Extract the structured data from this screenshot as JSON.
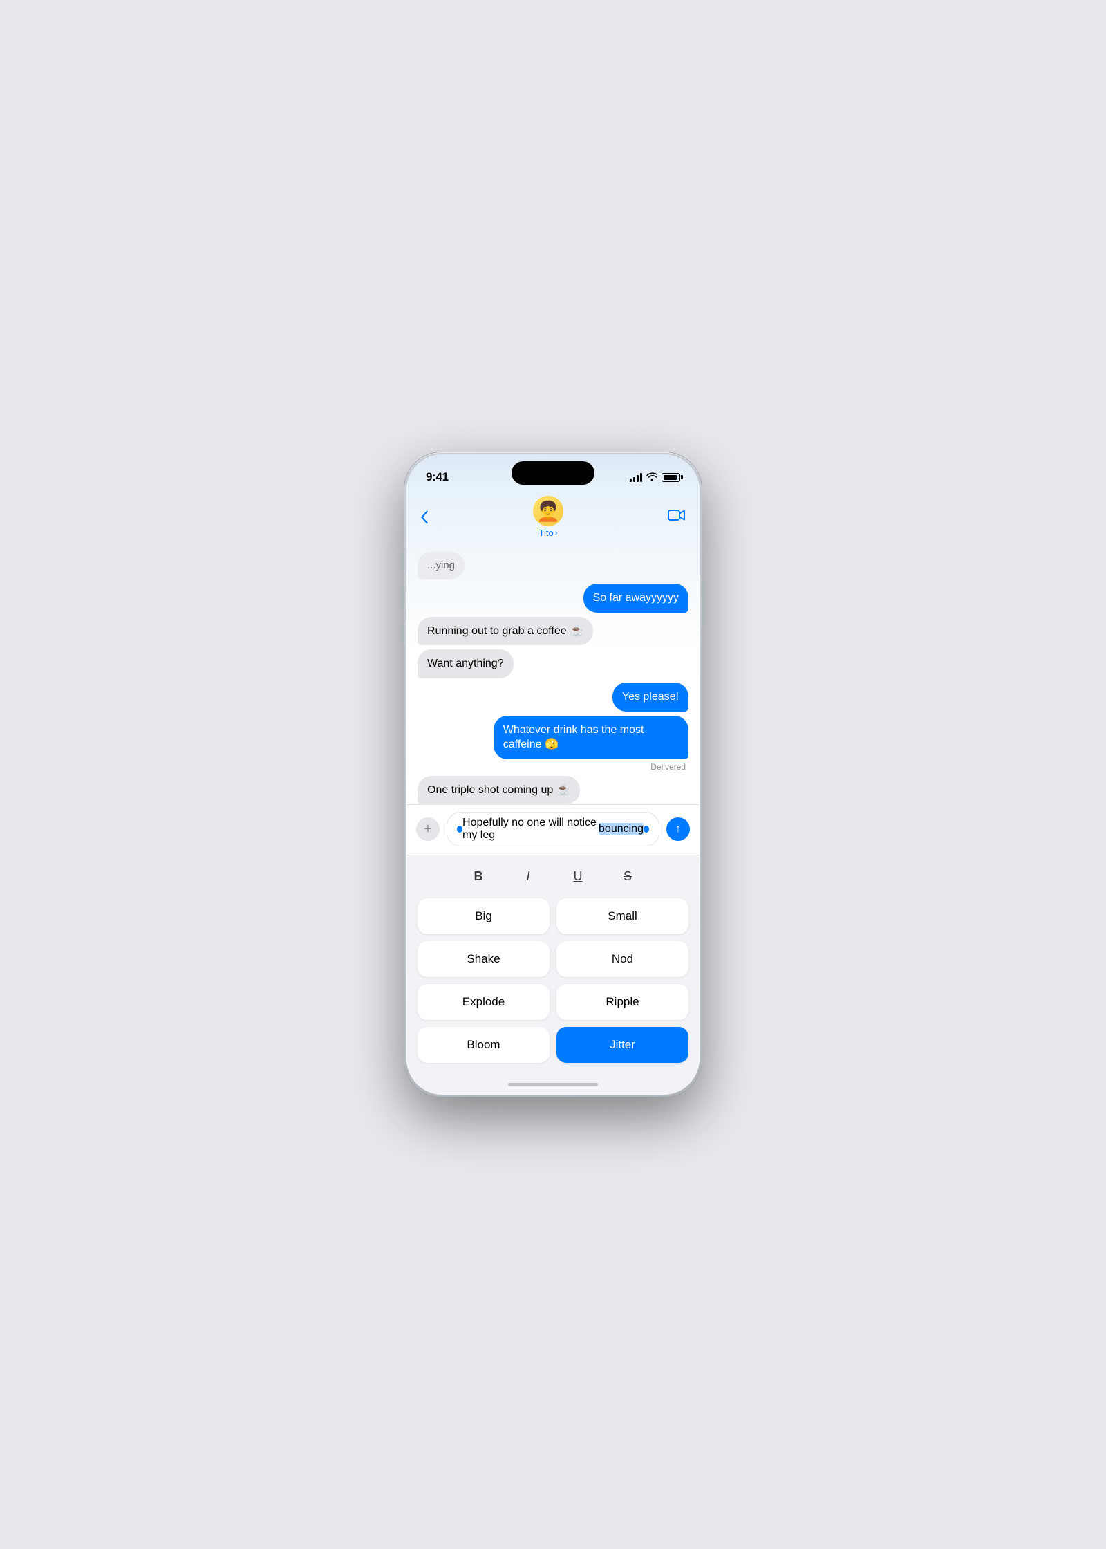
{
  "phone": {
    "status_bar": {
      "time": "9:41",
      "signal_bars": 4,
      "wifi": "wifi",
      "battery": "battery"
    },
    "nav": {
      "back_label": "‹",
      "contact_name": "Tito",
      "contact_chevron": "›",
      "video_icon": "video"
    },
    "messages": [
      {
        "id": "msg1",
        "type": "received",
        "partial": true,
        "text": "...ying"
      },
      {
        "id": "msg2",
        "type": "sent",
        "text": "So far awayyyyyy"
      },
      {
        "id": "msg3",
        "type": "received",
        "text": "Running out to grab a coffee ☕"
      },
      {
        "id": "msg4",
        "type": "received",
        "text": "Want anything?"
      },
      {
        "id": "msg5",
        "type": "sent",
        "text": "Yes please!"
      },
      {
        "id": "msg6",
        "type": "sent",
        "text": "Whatever drink has the most caffeine 🫣"
      },
      {
        "id": "msg7",
        "type": "delivered_label",
        "text": "Delivered"
      },
      {
        "id": "msg8",
        "type": "received",
        "text": "One triple shot coming up ☕"
      }
    ],
    "input": {
      "text_before_selection": "Hopefully no one will notice my leg ",
      "selected_text": "bouncing",
      "text_after_selection": "",
      "plus_icon": "+",
      "send_icon": "↑"
    },
    "format_bar": {
      "bold": "B",
      "italic": "I",
      "underline": "U",
      "strikethrough": "S"
    },
    "animation_buttons": [
      {
        "id": "big",
        "label": "Big",
        "active": false
      },
      {
        "id": "small",
        "label": "Small",
        "active": false
      },
      {
        "id": "shake",
        "label": "Shake",
        "active": false
      },
      {
        "id": "nod",
        "label": "Nod",
        "active": false
      },
      {
        "id": "explode",
        "label": "Explode",
        "active": false
      },
      {
        "id": "ripple",
        "label": "Ripple",
        "active": false
      },
      {
        "id": "bloom",
        "label": "Bloom",
        "active": false
      },
      {
        "id": "jitter",
        "label": "Jitter",
        "active": true
      }
    ]
  }
}
